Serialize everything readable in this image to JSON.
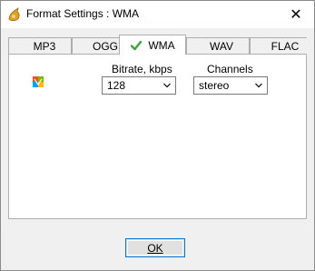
{
  "window": {
    "title": "Format Settings : WMA"
  },
  "titlebar": {
    "close_glyph": "✕"
  },
  "tabs": [
    {
      "label": "MP3",
      "active": false
    },
    {
      "label": "OGG",
      "active": false
    },
    {
      "label": "WMA",
      "active": true,
      "icon": "check-icon"
    },
    {
      "label": "WAV",
      "active": false
    },
    {
      "label": "FLAC",
      "active": false
    }
  ],
  "settings": {
    "bitrate_label": "Bitrate, kbps",
    "bitrate_value": "128",
    "channels_label": "Channels",
    "channels_value": "stereo",
    "format_icon": "wma-format-icon"
  },
  "buttons": {
    "ok_label": "OK"
  },
  "colors": {
    "accent": "#0078d7",
    "check": "#3aa53a",
    "panel_border": "#adadad"
  }
}
